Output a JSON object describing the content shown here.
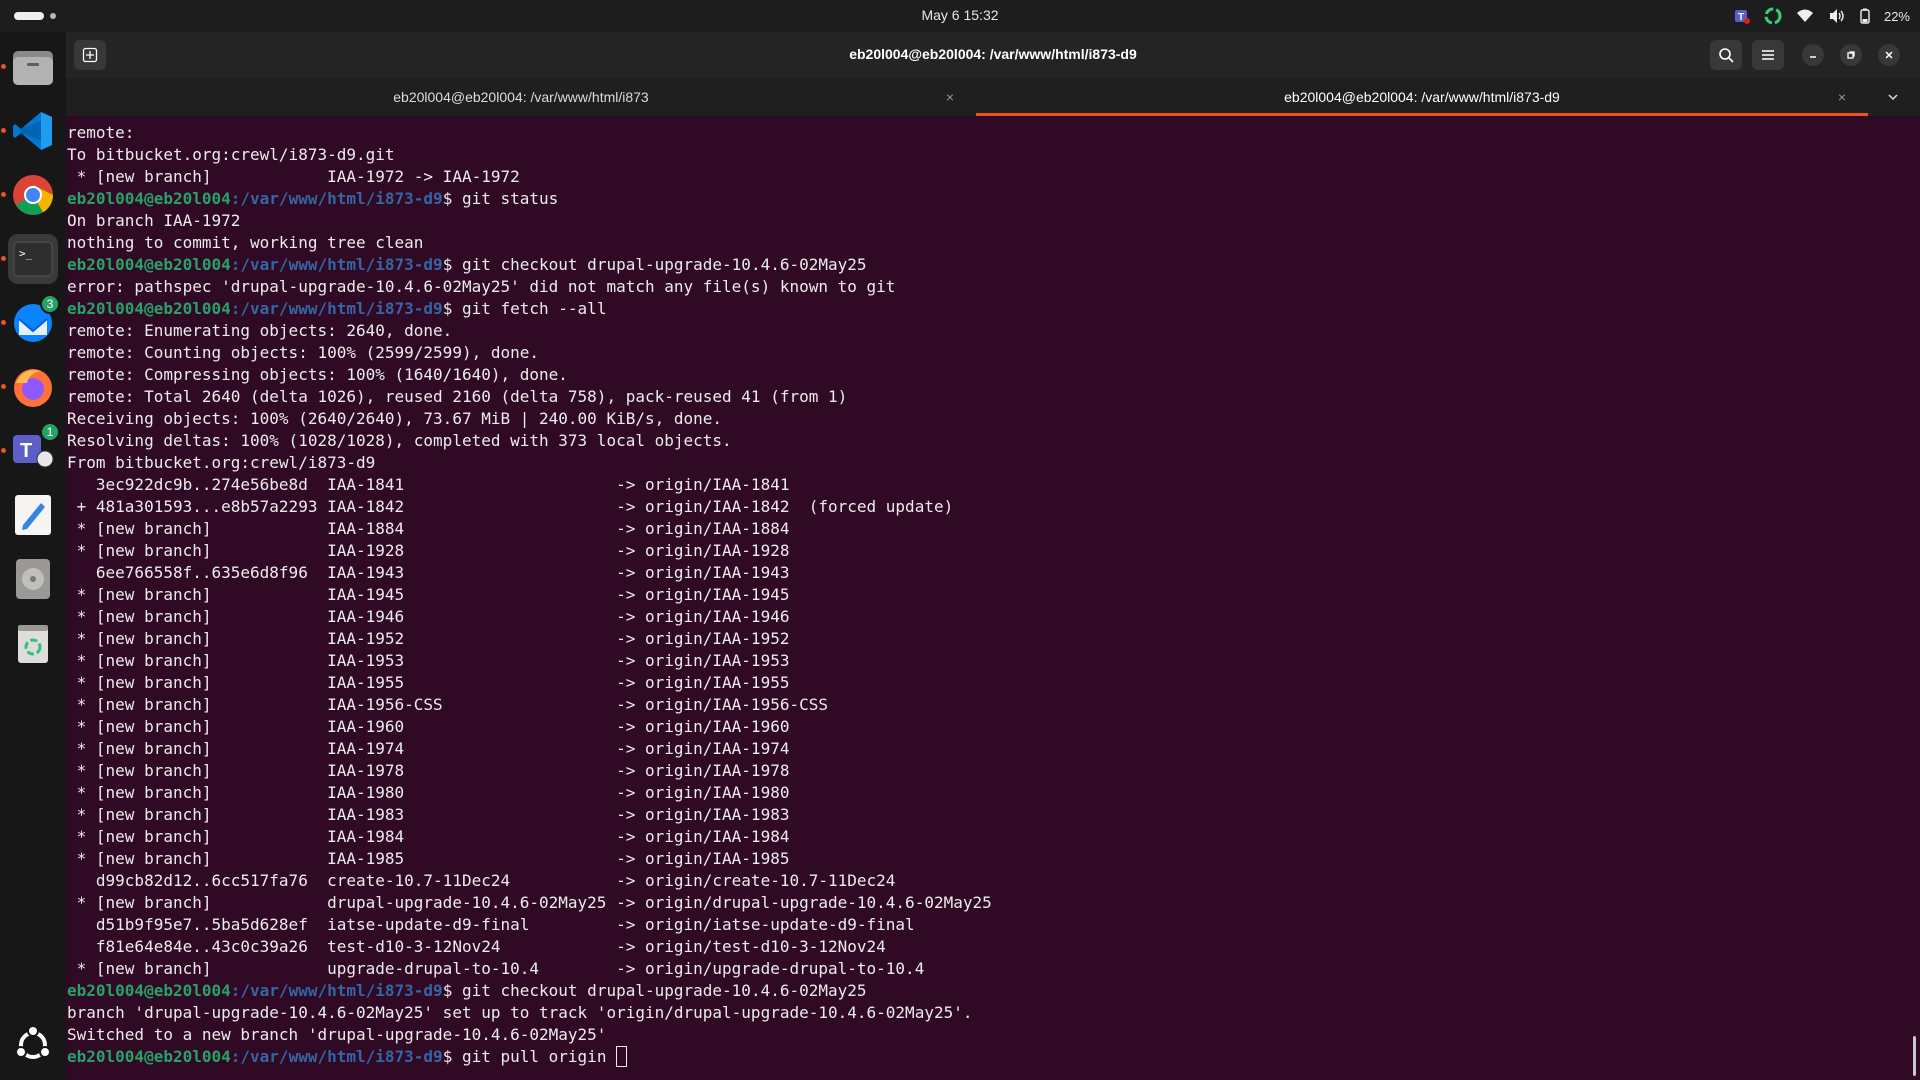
{
  "topbar": {
    "clock": "May 6  15:32",
    "battery": "22%"
  },
  "dock": {
    "apps": [
      {
        "name": "files-icon"
      },
      {
        "name": "vscode-icon"
      },
      {
        "name": "chrome-icon"
      },
      {
        "name": "terminal-icon"
      },
      {
        "name": "thunderbird-icon",
        "badge": "3"
      },
      {
        "name": "firefox-icon"
      },
      {
        "name": "teams-icon",
        "badge": "1"
      },
      {
        "name": "text-editor-icon"
      },
      {
        "name": "disk-icon"
      },
      {
        "name": "trash-icon"
      }
    ]
  },
  "window": {
    "title": "eb20l004@eb20l004: /var/www/html/i873-d9",
    "tabs": [
      {
        "label": "eb20l004@eb20l004: /var/www/html/i873",
        "close": "×"
      },
      {
        "label": "eb20l004@eb20l004: /var/www/html/i873-d9",
        "close": "×"
      }
    ]
  },
  "terminal": {
    "prompt_user": "eb20l004@eb20l004",
    "prompt_path": ":/var/www/html/i873-d9",
    "prompt_sym": "$ ",
    "lines": [
      "remote:",
      "To bitbucket.org:crewl/i873-d9.git",
      " * [new branch]            IAA-1972 -> IAA-1972",
      {
        "cmd": "git status"
      },
      "On branch IAA-1972",
      "nothing to commit, working tree clean",
      {
        "cmd": "git checkout drupal-upgrade-10.4.6-02May25"
      },
      "error: pathspec 'drupal-upgrade-10.4.6-02May25' did not match any file(s) known to git",
      {
        "cmd": "git fetch --all"
      },
      "remote: Enumerating objects: 2640, done.",
      "remote: Counting objects: 100% (2599/2599), done.",
      "remote: Compressing objects: 100% (1640/1640), done.",
      "remote: Total 2640 (delta 1026), reused 2160 (delta 758), pack-reused 41 (from 1)",
      "Receiving objects: 100% (2640/2640), 73.67 MiB | 240.00 KiB/s, done.",
      "Resolving deltas: 100% (1028/1028), completed with 373 local objects.",
      "From bitbucket.org:crewl/i873-d9",
      "   3ec922dc9b..274e56be8d  IAA-1841                      -> origin/IAA-1841",
      " + 481a301593...e8b57a2293 IAA-1842                      -> origin/IAA-1842  (forced update)",
      " * [new branch]            IAA-1884                      -> origin/IAA-1884",
      " * [new branch]            IAA-1928                      -> origin/IAA-1928",
      "   6ee766558f..635e6d8f96  IAA-1943                      -> origin/IAA-1943",
      " * [new branch]            IAA-1945                      -> origin/IAA-1945",
      " * [new branch]            IAA-1946                      -> origin/IAA-1946",
      " * [new branch]            IAA-1952                      -> origin/IAA-1952",
      " * [new branch]            IAA-1953                      -> origin/IAA-1953",
      " * [new branch]            IAA-1955                      -> origin/IAA-1955",
      " * [new branch]            IAA-1956-CSS                  -> origin/IAA-1956-CSS",
      " * [new branch]            IAA-1960                      -> origin/IAA-1960",
      " * [new branch]            IAA-1974                      -> origin/IAA-1974",
      " * [new branch]            IAA-1978                      -> origin/IAA-1978",
      " * [new branch]            IAA-1980                      -> origin/IAA-1980",
      " * [new branch]            IAA-1983                      -> origin/IAA-1983",
      " * [new branch]            IAA-1984                      -> origin/IAA-1984",
      " * [new branch]            IAA-1985                      -> origin/IAA-1985",
      "   d99cb82d12..6cc517fa76  create-10.7-11Dec24           -> origin/create-10.7-11Dec24",
      " * [new branch]            drupal-upgrade-10.4.6-02May25 -> origin/drupal-upgrade-10.4.6-02May25",
      "   d51b9f95e7..5ba5d628ef  iatse-update-d9-final         -> origin/iatse-update-d9-final",
      "   f81e64e84e..43c0c39a26  test-d10-3-12Nov24            -> origin/test-d10-3-12Nov24",
      " * [new branch]            upgrade-drupal-to-10.4        -> origin/upgrade-drupal-to-10.4",
      {
        "cmd": "git checkout drupal-upgrade-10.4.6-02May25"
      },
      "branch 'drupal-upgrade-10.4.6-02May25' set up to track 'origin/drupal-upgrade-10.4.6-02May25'.",
      "Switched to a new branch 'drupal-upgrade-10.4.6-02May25'",
      {
        "cmd": "git pull origin ",
        "cursor": true
      }
    ]
  }
}
